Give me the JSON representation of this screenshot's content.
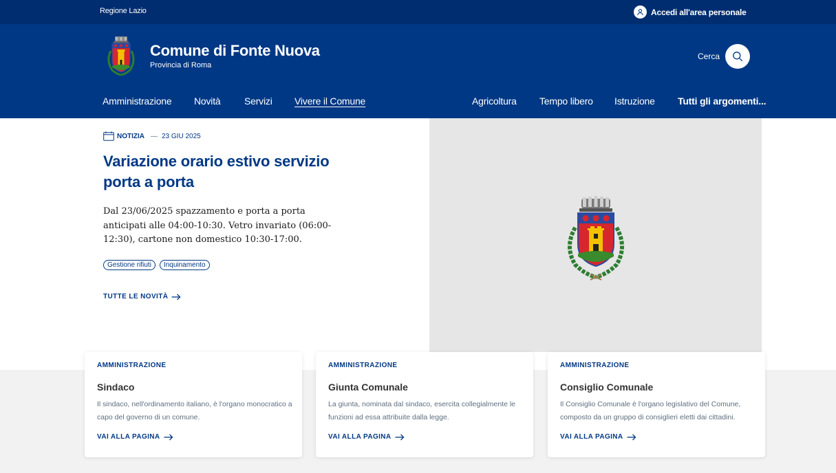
{
  "topbar": {
    "region": "Regione Lazio",
    "login_label": "Accedi all'area personale",
    "login_icon": "user-icon"
  },
  "header": {
    "title": "Comune di Fonte Nuova",
    "subtitle": "Provincia di Roma",
    "logo": "coat-of-arms",
    "search_label": "Cerca",
    "search_icon": "search-icon"
  },
  "nav": {
    "left": [
      "Amministrazione",
      "Novità",
      "Servizi",
      "Vivere il Comune"
    ],
    "right": [
      "Agricoltura",
      "Tempo libero",
      "Istruzione",
      "Tutti gli argomenti..."
    ],
    "active": "Vivere il Comune"
  },
  "hero": {
    "category": "NOTIZIA",
    "date": "23 GIU 2025",
    "title": "Variazione orario estivo servizio porta a porta",
    "description": "Dal 23/06/2025 spazzamento e porta a porta anticipati alle 04:00-10:30. Vetro invariato (06:00-12:30), cartone non domestico 10:30-17:00.",
    "tags": [
      "Gestione rifiuti",
      "Inquinamento"
    ],
    "more_label": "TUTTE LE NOVITÀ",
    "image": "coat-of-arms"
  },
  "cards": [
    {
      "kicker": "AMMINISTRAZIONE",
      "title": "Sindaco",
      "text": "Il sindaco, nell'ordinamento italiano, è l'organo monocratico a capo del governo di un comune.",
      "link": "VAI ALLA PAGINA"
    },
    {
      "kicker": "AMMINISTRAZIONE",
      "title": "Giunta Comunale",
      "text": "La giunta, nominata dal sindaco, esercita collegialmente le funzioni ad essa attribuite dalla legge.",
      "link": "VAI ALLA PAGINA"
    },
    {
      "kicker": "AMMINISTRAZIONE",
      "title": "Consiglio Comunale",
      "text": "Il Consiglio Comunale è l'organo legislativo del Comune, composto da un gruppo di consiglieri eletti dai cittadini.",
      "link": "VAI ALLA PAGINA"
    }
  ],
  "colors": {
    "topbar": "#002d6f",
    "header": "#003885",
    "accent": "#003885",
    "image_bg": "#e6e6e6",
    "section_bg": "#f2f2f2"
  }
}
